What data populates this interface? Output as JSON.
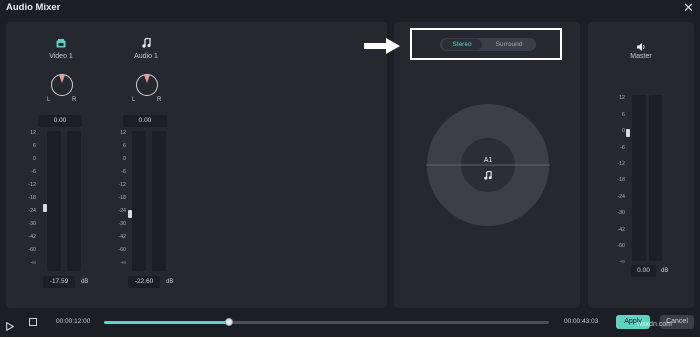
{
  "window": {
    "title": "Audio Mixer",
    "close_glyph": "✕"
  },
  "tracks": [
    {
      "name": "Video 1",
      "icon": "video-track-icon",
      "pan_left": "L",
      "pan_right": "R",
      "pan_value": "0.00",
      "db_value": "-17.59",
      "db_unit": "dB",
      "fader_level_db": -18
    },
    {
      "name": "Audio 1",
      "icon": "music-note-icon",
      "pan_left": "L",
      "pan_right": "R",
      "pan_value": "0.00",
      "db_value": "-22.60",
      "db_unit": "dB",
      "fader_level_db": -24
    }
  ],
  "scale_ticks": [
    "12",
    "6",
    "0",
    "-6",
    "-12",
    "-18",
    "-24",
    "-30",
    "-42",
    "-60",
    "-∞"
  ],
  "panner": {
    "modes": [
      "Stereo",
      "Surround"
    ],
    "selected_mode": "Stereo",
    "source_label": "A1",
    "source_icon": "music-note-icon",
    "callout_arrow": "arrow-right-icon"
  },
  "master": {
    "label": "Master",
    "icon": "speaker-icon",
    "db_value": "0.00",
    "db_unit": "dB",
    "fader_level_db": 0,
    "scale_ticks": [
      "12",
      "6",
      "0",
      "-6",
      "-12",
      "-18",
      "-24",
      "-30",
      "-42",
      "-60",
      "-∞"
    ]
  },
  "transport": {
    "current_time": "00:00:12:00",
    "total_time": "00:00:43:03",
    "progress": 0.28,
    "apply_label": "Apply",
    "cancel_label": "Cancel",
    "watermark": "wsxdn.com"
  },
  "colors": {
    "accent": "#5fd3c1",
    "callout_border": "#ffffff",
    "pan_marker": "#e59a94"
  }
}
